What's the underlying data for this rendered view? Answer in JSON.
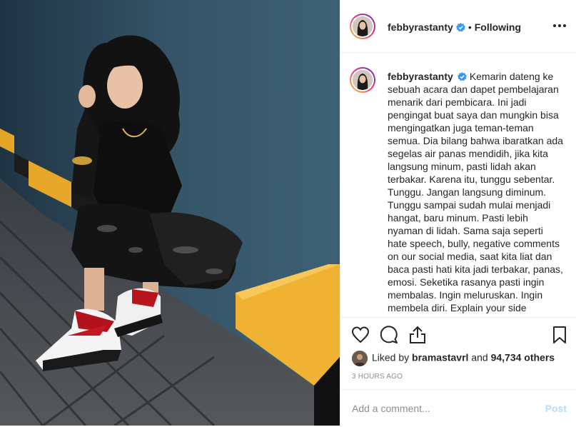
{
  "header": {
    "username": "febbyrastanty",
    "separator": "•",
    "follow_status": "Following"
  },
  "caption": {
    "username": "febbyrastanty",
    "text": "Kemarin dateng ke sebuah acara dan dapet pembelajaran menarik dari pembicara. Ini jadi pengingat buat saya dan mungkin bisa mengingatkan juga teman-teman semua. Dia bilang bahwa ibaratkan ada segelas air panas mendidih, jika kita langsung minum, pasti lidah akan terbakar. Karena itu, tunggu sebentar. Tunggu. Jangan langsung diminum. Tunggu sampai sudah mulai menjadi hangat, baru minum. Pasti lebih nyaman di lidah. Sama saja seperti hate speech, bully, negative comments on our social media, saat kita liat dan baca pasti hati kita jadi terbakar, panas, emosi. Seketika rasanya pasti ingin membalas. Ingin meluruskan. Ingin membela diri. Explain your side"
  },
  "likes": {
    "prefix": "Liked by",
    "user": "bramastavrl",
    "and": "and",
    "count": "94,734 others"
  },
  "timestamp": "3 HOURS AGO",
  "comment": {
    "placeholder": "Add a comment...",
    "post_label": "Post"
  },
  "icons": [
    "heart-icon",
    "comment-icon",
    "share-icon",
    "bookmark-icon",
    "more-options-icon",
    "verified-badge-icon"
  ],
  "colors": {
    "verified": "#3897f0",
    "post_disabled": "#b2dffc",
    "muted_text": "#8e8e8e"
  }
}
